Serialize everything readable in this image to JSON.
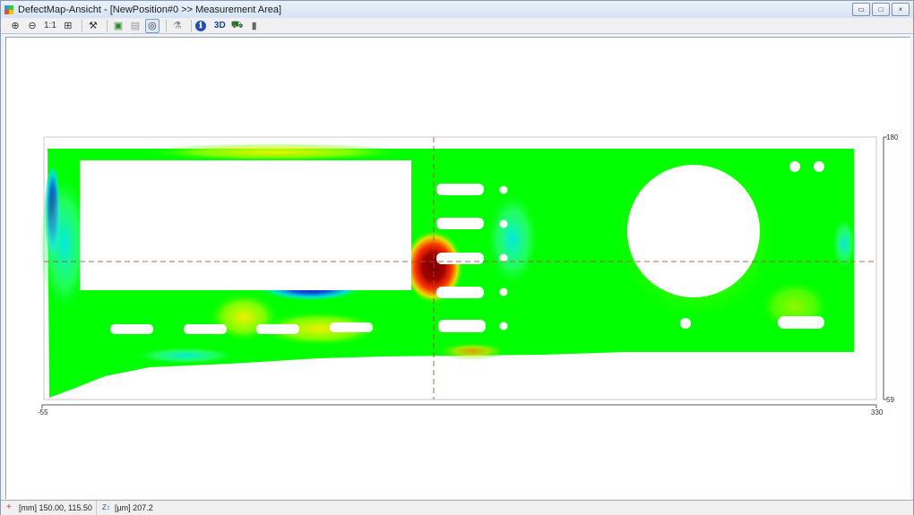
{
  "window": {
    "title": "DefectMap-Ansicht - [NewPosition#0 >> Measurement Area]",
    "controls": {
      "minimize": "▭",
      "maximize": "□",
      "close": "×"
    }
  },
  "toolbar": {
    "buttons": [
      {
        "id": "zoom-in",
        "icon": "zoom-in-icon",
        "glyph": "⊕"
      },
      {
        "id": "zoom-out",
        "icon": "zoom-out-icon",
        "glyph": "⊖"
      },
      {
        "id": "zoom-1to1",
        "label": "1:1"
      },
      {
        "id": "grid",
        "icon": "grid-icon",
        "glyph": "⊞"
      },
      {
        "id": "tools",
        "icon": "tools-icon",
        "glyph": "⚒"
      },
      {
        "id": "image",
        "icon": "image-icon",
        "glyph": "▣"
      },
      {
        "id": "layers",
        "icon": "layers-icon",
        "glyph": "▤"
      },
      {
        "id": "target",
        "icon": "target-icon",
        "glyph": "◎"
      },
      {
        "id": "flask",
        "icon": "flask-icon",
        "glyph": "⚗"
      },
      {
        "id": "info",
        "icon": "info-icon",
        "glyph": "ℹ"
      },
      {
        "id": "three-d",
        "label": "3D"
      },
      {
        "id": "car",
        "icon": "car-icon",
        "glyph": "⛟"
      },
      {
        "id": "scale",
        "icon": "scale-bar-icon",
        "glyph": "▮"
      }
    ]
  },
  "map": {
    "x_axis": {
      "min_label": "-55",
      "max_label": "330"
    },
    "y_axis": {
      "min_label": "59",
      "max_label": "180"
    },
    "colors": {
      "background": "#ffffff",
      "field": "#00ff00",
      "hot": "#7a0000",
      "warm": "#ff3300",
      "yellow": "#ffee00",
      "cold": "#1030c0",
      "cyan": "#00ddff",
      "crosshair": "#a0522d"
    }
  },
  "status": {
    "position": "[mm] 150.00, 115.50",
    "z_value": "[µm] 207.2"
  }
}
